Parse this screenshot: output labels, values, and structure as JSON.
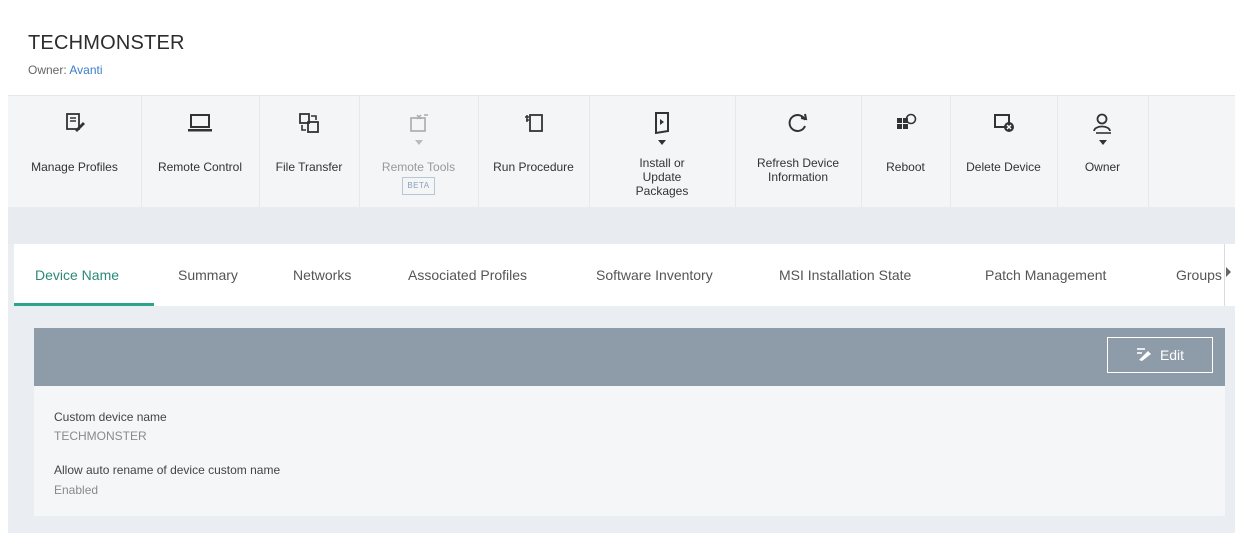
{
  "device": {
    "name": "TECHMONSTER",
    "owner_label": "Owner:",
    "owner_name": "Avanti"
  },
  "toolbar": {
    "items": [
      {
        "label": "Manage Profiles",
        "icon": "manage-profiles-icon"
      },
      {
        "label": "Remote Control",
        "icon": "laptop-icon"
      },
      {
        "label": "File Transfer",
        "icon": "file-transfer-icon"
      },
      {
        "label": "Remote Tools",
        "icon": "remote-tools-icon",
        "badge": "BETA",
        "disabled": true
      },
      {
        "label": "Run Procedure",
        "icon": "run-procedure-icon"
      },
      {
        "label": "Install or Update Packages",
        "icon": "install-packages-icon",
        "dropdown": true
      },
      {
        "label": "Refresh Device Information",
        "icon": "refresh-icon"
      },
      {
        "label": "Reboot",
        "icon": "reboot-icon"
      },
      {
        "label": "Delete Device",
        "icon": "delete-device-icon"
      },
      {
        "label": "Owner",
        "icon": "owner-icon",
        "dropdown": true
      }
    ]
  },
  "tabs": [
    {
      "label": "Device Name",
      "active": true
    },
    {
      "label": "Summary"
    },
    {
      "label": "Networks"
    },
    {
      "label": "Associated Profiles"
    },
    {
      "label": "Software Inventory"
    },
    {
      "label": "MSI Installation State"
    },
    {
      "label": "Patch Management"
    },
    {
      "label": "Groups"
    }
  ],
  "panel": {
    "edit_label": "Edit",
    "fields": [
      {
        "label": "Custom device name",
        "value": "TECHMONSTER"
      },
      {
        "label": "Allow auto rename of device custom name",
        "value": "Enabled"
      }
    ]
  },
  "colors": {
    "accent": "#2aa58b",
    "link": "#3d7ec8",
    "panel_header": "#8e9ba9"
  }
}
